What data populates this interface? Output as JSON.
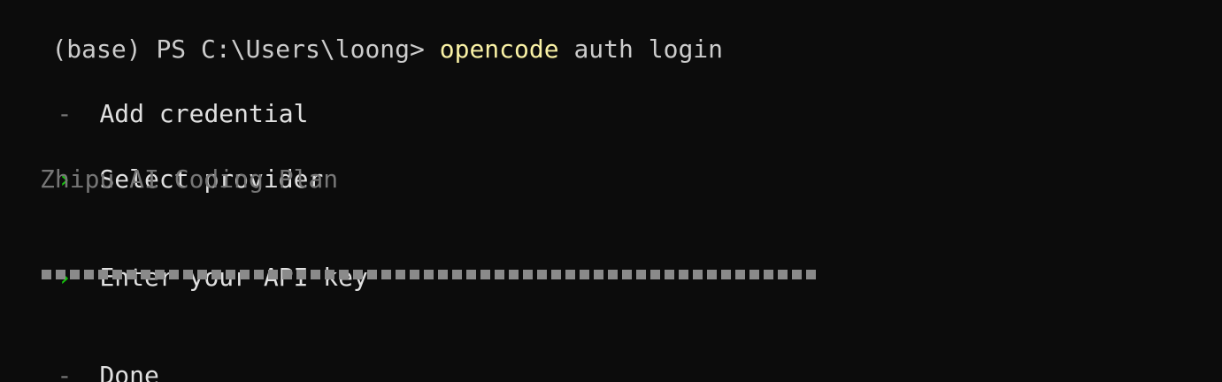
{
  "terminal": {
    "prompt": "(base) PS C:\\Users\\loong> ",
    "command": "opencode",
    "args": " auth login"
  },
  "wizard": {
    "title_marker": "-",
    "title": "Add credential",
    "steps": [
      {
        "marker": "›",
        "label": "Select provider",
        "value": "Zhipu AI Coding Plan"
      },
      {
        "marker": "›",
        "label": "Enter your API key",
        "value": "▪▪▪▪▪▪▪▪▪▪▪▪▪▪▪▪▪▪▪▪▪▪▪▪▪▪▪▪▪▪▪▪▪▪▪▪▪▪▪▪▪▪▪▪▪▪▪▪▪▪▪▪▪▪▪"
      }
    ],
    "done_marker": "-",
    "done_label": "Done"
  },
  "colors": {
    "background": "#0c0c0c",
    "foreground": "#cccccc",
    "command": "#f9f1a5",
    "success_arrow": "#16c60c",
    "muted": "#767676"
  }
}
